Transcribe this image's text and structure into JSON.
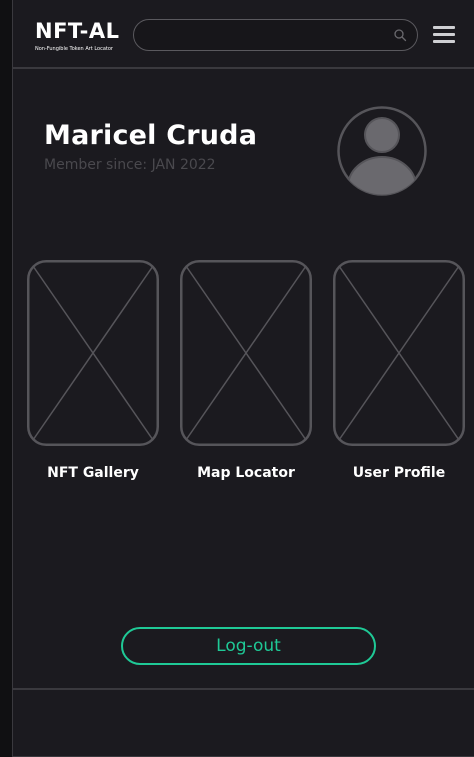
{
  "header": {
    "brand_title": "NFT-AL",
    "brand_subtitle": "Non-Fungible Token Art Locator",
    "search_placeholder": "",
    "search_icon": "search-icon",
    "menu_icon": "hamburger-menu-icon"
  },
  "profile": {
    "name": "Maricel Cruda",
    "member_since": "Member since: JAN 2022",
    "avatar_icon": "user-avatar-icon"
  },
  "tiles": [
    {
      "label": "NFT Gallery",
      "icon": "image-placeholder-icon"
    },
    {
      "label": "Map Locator",
      "icon": "image-placeholder-icon"
    },
    {
      "label": "User Profile",
      "icon": "image-placeholder-icon"
    }
  ],
  "actions": {
    "logout_label": "Log-out"
  },
  "colors": {
    "background": "#1b1a1f",
    "border": "#3a393e",
    "accent": "#1fc996",
    "muted_text": "#4a494e",
    "placeholder_stroke": "#56555a"
  }
}
